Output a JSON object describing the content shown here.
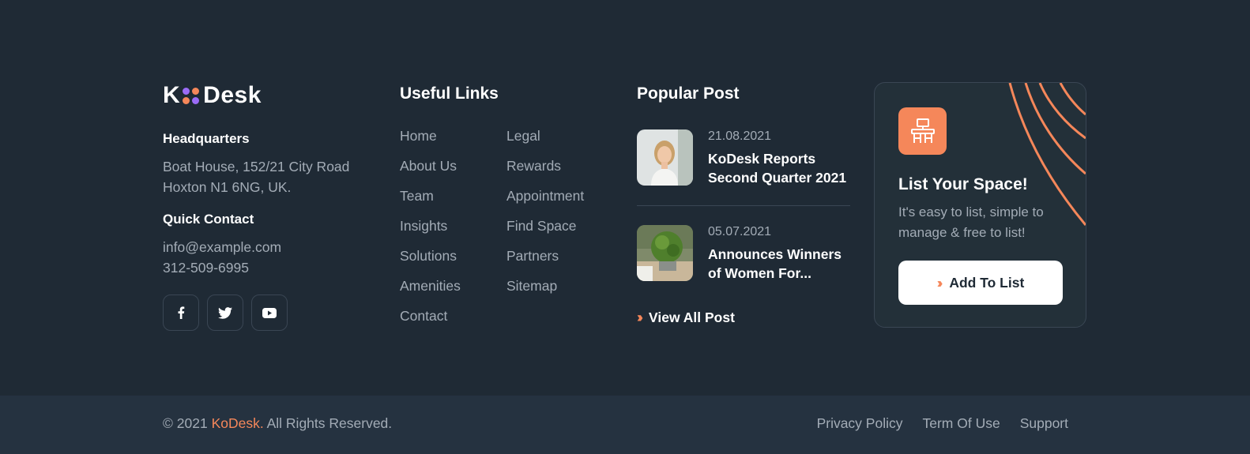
{
  "brand": {
    "letter_k": "K",
    "name": "Desk",
    "dot_colors": [
      "#9b6cf7",
      "#f5875a",
      "#f5875a",
      "#9b6cf7"
    ]
  },
  "contact": {
    "hq_heading": "Headquarters",
    "address_line1": "Boat House, 152/21 City Road",
    "address_line2": "Hoxton N1 6NG, UK.",
    "quick_heading": "Quick Contact",
    "email": "info@example.com",
    "phone": "312-509-6995"
  },
  "socials": [
    {
      "icon": "facebook-icon"
    },
    {
      "icon": "twitter-icon"
    },
    {
      "icon": "youtube-icon"
    }
  ],
  "useful_links": {
    "title": "Useful Links",
    "col1": [
      "Home",
      "About Us",
      "Team",
      "Insights",
      "Solutions",
      "Amenities",
      "Contact"
    ],
    "col2": [
      "Legal",
      "Rewards",
      "Appointment",
      "Find Space",
      "Partners",
      "Sitemap"
    ]
  },
  "popular_post": {
    "title": "Popular Post",
    "posts": [
      {
        "date": "21.08.2021",
        "title": "KoDesk Reports Second Quarter 2021"
      },
      {
        "date": "05.07.2021",
        "title": "Announces Winners of Women For..."
      }
    ],
    "view_all": "View All Post"
  },
  "cta": {
    "title": "List Your Space!",
    "description": "It's easy to list, simple to manage & free to list!",
    "button": "Add To List"
  },
  "bottom": {
    "copyright_prefix": "© 2021",
    "brand": "KoDesk.",
    "copyright_suffix": "All Rights Reserved.",
    "links": [
      "Privacy Policy",
      "Term Of Use",
      "Support"
    ]
  },
  "colors": {
    "accent": "#f5875a",
    "purple": "#9b6cf7",
    "bg": "#1f2a35",
    "bottom_bg": "#253240"
  }
}
